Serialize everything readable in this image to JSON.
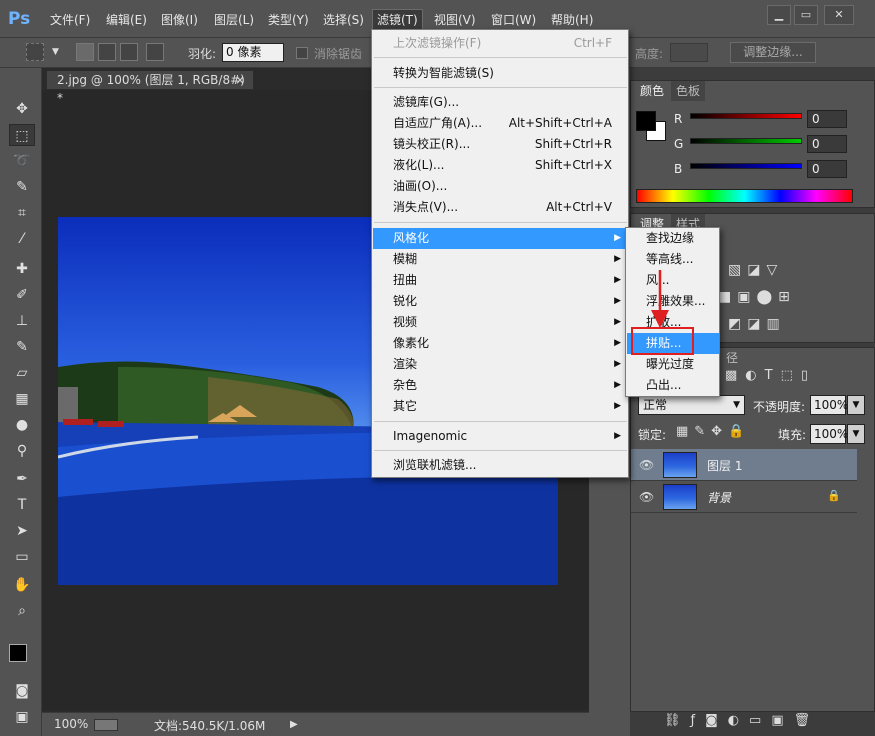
{
  "app": {
    "logo": "Ps"
  },
  "menubar": {
    "items": [
      "文件(F)",
      "编辑(E)",
      "图像(I)",
      "图层(L)",
      "类型(Y)",
      "选择(S)",
      "滤镜(T)",
      "视图(V)",
      "窗口(W)",
      "帮助(H)"
    ],
    "active": "滤镜(T)",
    "window_buttons": [
      "▁",
      "▭",
      "✕"
    ]
  },
  "options": {
    "feather_label": "羽化:",
    "feather_value": "0 像素",
    "antialias_label": "消除锯齿",
    "height_label": "高度:",
    "refine_edge": "调整边缘..."
  },
  "document": {
    "tab_title": "2.jpg @ 100% (图层 1, RGB/8#) *",
    "close": "×"
  },
  "status": {
    "zoom": "100%",
    "doc_size": "文档:540.5K/1.06M"
  },
  "color_panel": {
    "tabs": [
      "颜色",
      "色板"
    ],
    "channels": [
      {
        "name": "R",
        "value": "0",
        "color": "#ff0000"
      },
      {
        "name": "G",
        "value": "0",
        "color": "#00cc00"
      },
      {
        "name": "B",
        "value": "0",
        "color": "#0000ff"
      }
    ],
    "foreground": "#000000",
    "background": "#ffffff"
  },
  "adjust_panel": {
    "tabs": [
      "调整",
      "样式"
    ]
  },
  "layers_panel": {
    "tab_partial": "径",
    "blend_mode": "正常",
    "opacity_label": "不透明度:",
    "opacity": "100%",
    "lock_label": "锁定:",
    "fill_label": "填充:",
    "fill": "100%",
    "layers": [
      {
        "name": "图层 1",
        "selected": true,
        "locked": false
      },
      {
        "name": "背景",
        "selected": false,
        "locked": true
      }
    ]
  },
  "filter_menu": {
    "last_filter": {
      "label": "上次滤镜操作(F)",
      "shortcut": "Ctrl+F"
    },
    "smart_filter": "转换为智能滤镜(S)",
    "group1": [
      {
        "label": "滤镜库(G)...",
        "shortcut": ""
      },
      {
        "label": "自适应广角(A)...",
        "shortcut": "Alt+Shift+Ctrl+A"
      },
      {
        "label": "镜头校正(R)...",
        "shortcut": "Shift+Ctrl+R"
      },
      {
        "label": "液化(L)...",
        "shortcut": "Shift+Ctrl+X"
      },
      {
        "label": "油画(O)...",
        "shortcut": ""
      },
      {
        "label": "消失点(V)...",
        "shortcut": "Alt+Ctrl+V"
      }
    ],
    "submenus": [
      "风格化",
      "模糊",
      "扭曲",
      "锐化",
      "视频",
      "像素化",
      "渲染",
      "杂色",
      "其它"
    ],
    "highlighted": "风格化",
    "plugin": "Imagenomic",
    "browse": "浏览联机滤镜..."
  },
  "stylize_submenu": {
    "items": [
      "查找边缘",
      "等高线...",
      "风...",
      "浮雕效果...",
      "扩散...",
      "拼贴...",
      "曝光过度",
      "凸出..."
    ],
    "highlighted": "拼贴..."
  }
}
